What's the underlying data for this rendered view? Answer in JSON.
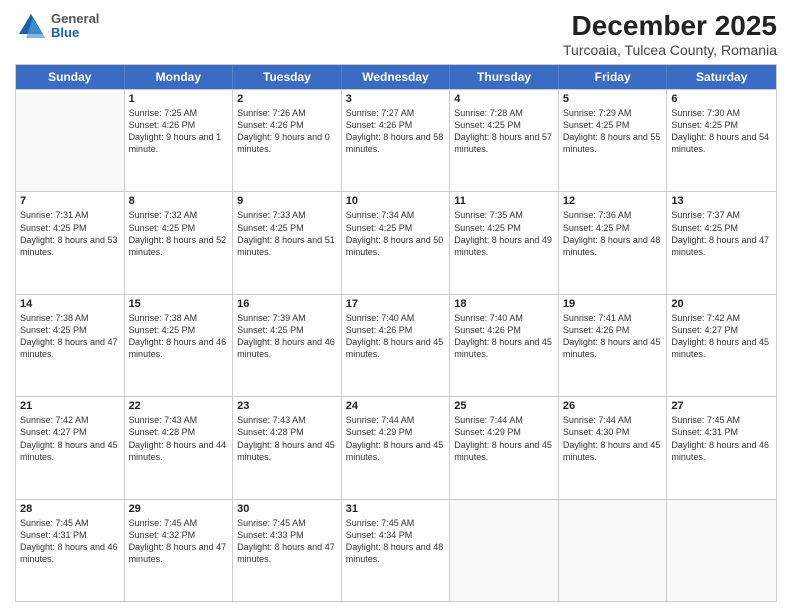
{
  "header": {
    "logo": {
      "general": "General",
      "blue": "Blue"
    },
    "title": "December 2025",
    "subtitle": "Turcoaia, Tulcea County, Romania"
  },
  "days": [
    "Sunday",
    "Monday",
    "Tuesday",
    "Wednesday",
    "Thursday",
    "Friday",
    "Saturday"
  ],
  "weeks": [
    [
      {
        "day": "",
        "sunrise": "",
        "sunset": "",
        "daylight": ""
      },
      {
        "day": "1",
        "sunrise": "Sunrise: 7:25 AM",
        "sunset": "Sunset: 4:26 PM",
        "daylight": "Daylight: 9 hours and 1 minute."
      },
      {
        "day": "2",
        "sunrise": "Sunrise: 7:26 AM",
        "sunset": "Sunset: 4:26 PM",
        "daylight": "Daylight: 9 hours and 0 minutes."
      },
      {
        "day": "3",
        "sunrise": "Sunrise: 7:27 AM",
        "sunset": "Sunset: 4:26 PM",
        "daylight": "Daylight: 8 hours and 58 minutes."
      },
      {
        "day": "4",
        "sunrise": "Sunrise: 7:28 AM",
        "sunset": "Sunset: 4:25 PM",
        "daylight": "Daylight: 8 hours and 57 minutes."
      },
      {
        "day": "5",
        "sunrise": "Sunrise: 7:29 AM",
        "sunset": "Sunset: 4:25 PM",
        "daylight": "Daylight: 8 hours and 55 minutes."
      },
      {
        "day": "6",
        "sunrise": "Sunrise: 7:30 AM",
        "sunset": "Sunset: 4:25 PM",
        "daylight": "Daylight: 8 hours and 54 minutes."
      }
    ],
    [
      {
        "day": "7",
        "sunrise": "Sunrise: 7:31 AM",
        "sunset": "Sunset: 4:25 PM",
        "daylight": "Daylight: 8 hours and 53 minutes."
      },
      {
        "day": "8",
        "sunrise": "Sunrise: 7:32 AM",
        "sunset": "Sunset: 4:25 PM",
        "daylight": "Daylight: 8 hours and 52 minutes."
      },
      {
        "day": "9",
        "sunrise": "Sunrise: 7:33 AM",
        "sunset": "Sunset: 4:25 PM",
        "daylight": "Daylight: 8 hours and 51 minutes."
      },
      {
        "day": "10",
        "sunrise": "Sunrise: 7:34 AM",
        "sunset": "Sunset: 4:25 PM",
        "daylight": "Daylight: 8 hours and 50 minutes."
      },
      {
        "day": "11",
        "sunrise": "Sunrise: 7:35 AM",
        "sunset": "Sunset: 4:25 PM",
        "daylight": "Daylight: 8 hours and 49 minutes."
      },
      {
        "day": "12",
        "sunrise": "Sunrise: 7:36 AM",
        "sunset": "Sunset: 4:25 PM",
        "daylight": "Daylight: 8 hours and 48 minutes."
      },
      {
        "day": "13",
        "sunrise": "Sunrise: 7:37 AM",
        "sunset": "Sunset: 4:25 PM",
        "daylight": "Daylight: 8 hours and 47 minutes."
      }
    ],
    [
      {
        "day": "14",
        "sunrise": "Sunrise: 7:38 AM",
        "sunset": "Sunset: 4:25 PM",
        "daylight": "Daylight: 8 hours and 47 minutes."
      },
      {
        "day": "15",
        "sunrise": "Sunrise: 7:38 AM",
        "sunset": "Sunset: 4:25 PM",
        "daylight": "Daylight: 8 hours and 46 minutes."
      },
      {
        "day": "16",
        "sunrise": "Sunrise: 7:39 AM",
        "sunset": "Sunset: 4:25 PM",
        "daylight": "Daylight: 8 hours and 46 minutes."
      },
      {
        "day": "17",
        "sunrise": "Sunrise: 7:40 AM",
        "sunset": "Sunset: 4:26 PM",
        "daylight": "Daylight: 8 hours and 45 minutes."
      },
      {
        "day": "18",
        "sunrise": "Sunrise: 7:40 AM",
        "sunset": "Sunset: 4:26 PM",
        "daylight": "Daylight: 8 hours and 45 minutes."
      },
      {
        "day": "19",
        "sunrise": "Sunrise: 7:41 AM",
        "sunset": "Sunset: 4:26 PM",
        "daylight": "Daylight: 8 hours and 45 minutes."
      },
      {
        "day": "20",
        "sunrise": "Sunrise: 7:42 AM",
        "sunset": "Sunset: 4:27 PM",
        "daylight": "Daylight: 8 hours and 45 minutes."
      }
    ],
    [
      {
        "day": "21",
        "sunrise": "Sunrise: 7:42 AM",
        "sunset": "Sunset: 4:27 PM",
        "daylight": "Daylight: 8 hours and 45 minutes."
      },
      {
        "day": "22",
        "sunrise": "Sunrise: 7:43 AM",
        "sunset": "Sunset: 4:28 PM",
        "daylight": "Daylight: 8 hours and 44 minutes."
      },
      {
        "day": "23",
        "sunrise": "Sunrise: 7:43 AM",
        "sunset": "Sunset: 4:28 PM",
        "daylight": "Daylight: 8 hours and 45 minutes."
      },
      {
        "day": "24",
        "sunrise": "Sunrise: 7:44 AM",
        "sunset": "Sunset: 4:29 PM",
        "daylight": "Daylight: 8 hours and 45 minutes."
      },
      {
        "day": "25",
        "sunrise": "Sunrise: 7:44 AM",
        "sunset": "Sunset: 4:29 PM",
        "daylight": "Daylight: 8 hours and 45 minutes."
      },
      {
        "day": "26",
        "sunrise": "Sunrise: 7:44 AM",
        "sunset": "Sunset: 4:30 PM",
        "daylight": "Daylight: 8 hours and 45 minutes."
      },
      {
        "day": "27",
        "sunrise": "Sunrise: 7:45 AM",
        "sunset": "Sunset: 4:31 PM",
        "daylight": "Daylight: 8 hours and 46 minutes."
      }
    ],
    [
      {
        "day": "28",
        "sunrise": "Sunrise: 7:45 AM",
        "sunset": "Sunset: 4:31 PM",
        "daylight": "Daylight: 8 hours and 46 minutes."
      },
      {
        "day": "29",
        "sunrise": "Sunrise: 7:45 AM",
        "sunset": "Sunset: 4:32 PM",
        "daylight": "Daylight: 8 hours and 47 minutes."
      },
      {
        "day": "30",
        "sunrise": "Sunrise: 7:45 AM",
        "sunset": "Sunset: 4:33 PM",
        "daylight": "Daylight: 8 hours and 47 minutes."
      },
      {
        "day": "31",
        "sunrise": "Sunrise: 7:45 AM",
        "sunset": "Sunset: 4:34 PM",
        "daylight": "Daylight: 8 hours and 48 minutes."
      },
      {
        "day": "",
        "sunrise": "",
        "sunset": "",
        "daylight": ""
      },
      {
        "day": "",
        "sunrise": "",
        "sunset": "",
        "daylight": ""
      },
      {
        "day": "",
        "sunrise": "",
        "sunset": "",
        "daylight": ""
      }
    ]
  ]
}
